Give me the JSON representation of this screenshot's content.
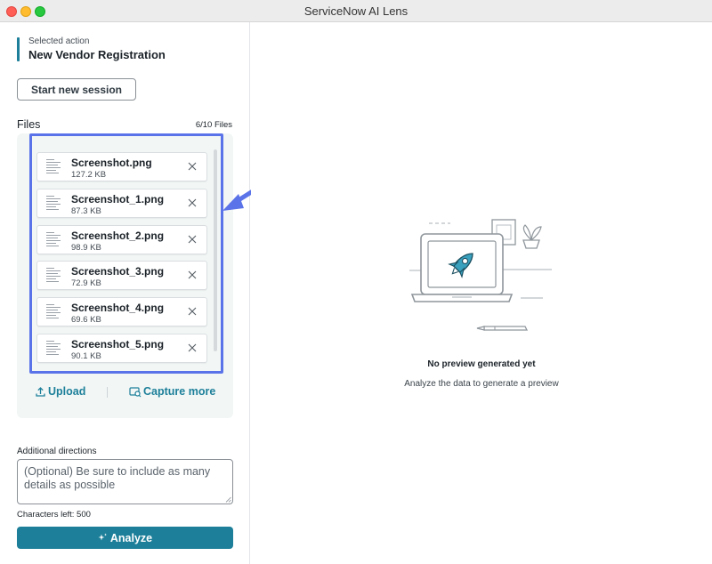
{
  "window": {
    "title": "ServiceNow AI Lens"
  },
  "selected_action": {
    "label": "Selected action",
    "value": "New Vendor Registration"
  },
  "session": {
    "start_label": "Start new session"
  },
  "files": {
    "title": "Files",
    "count": "6/10 Files",
    "items": [
      {
        "name": "Screenshot.png",
        "size": "127.2 KB"
      },
      {
        "name": "Screenshot_1.png",
        "size": "87.3 KB"
      },
      {
        "name": "Screenshot_2.png",
        "size": "98.9 KB"
      },
      {
        "name": "Screenshot_3.png",
        "size": "72.9 KB"
      },
      {
        "name": "Screenshot_4.png",
        "size": "69.6 KB"
      },
      {
        "name": "Screenshot_5.png",
        "size": "90.1 KB"
      }
    ],
    "upload_label": "Upload",
    "capture_label": "Capture more"
  },
  "directions": {
    "label": "Additional directions",
    "placeholder": "(Optional) Be sure to include as many details as possible",
    "chars_left": "Characters left: 500"
  },
  "analyze": {
    "label": "Analyze"
  },
  "preview": {
    "title": "No preview generated yet",
    "subtitle": "Analyze the data to generate a preview"
  },
  "colors": {
    "accent": "#1d7f99",
    "highlight": "#5b73e8",
    "files_bg": "#f2f7f6"
  },
  "icons": [
    "upload-icon",
    "capture-icon",
    "close-icon",
    "sparkle-icon",
    "rocket-icon",
    "file-thumbnail-icon"
  ]
}
